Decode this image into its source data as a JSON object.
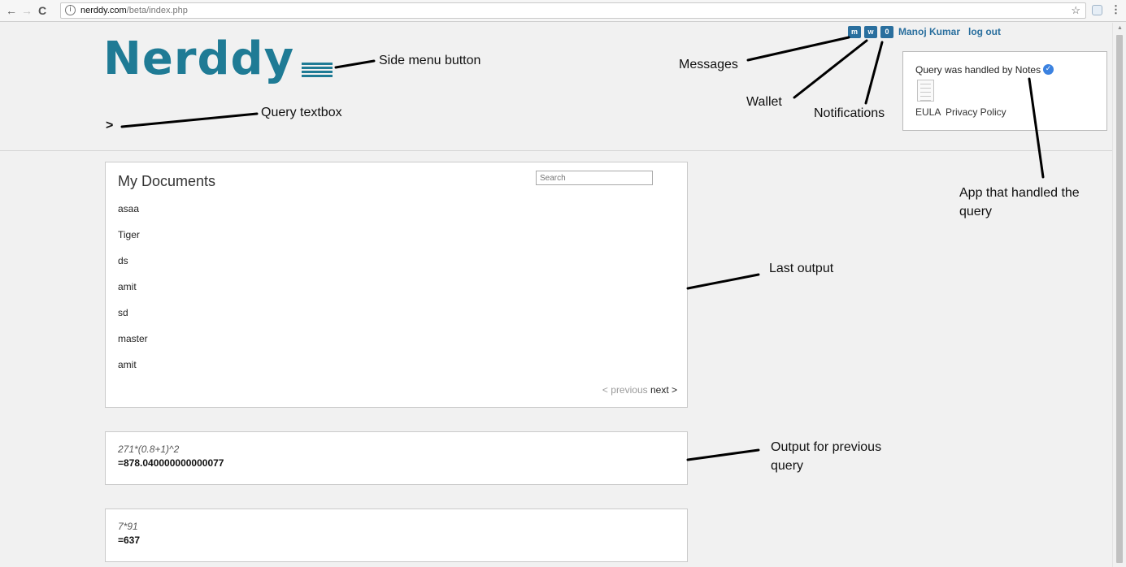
{
  "browser": {
    "url_host": "nerddy.com",
    "url_path": "/beta/index.php",
    "back_icon": "←",
    "forward_icon": "→",
    "reload_icon": "C",
    "info_icon": "i",
    "star_icon": "☆",
    "menu_icon": "⋮"
  },
  "header": {
    "logo": "Nerddy",
    "prompt": ">",
    "badges": {
      "messages": "m",
      "wallet": "w",
      "notifications": "0"
    },
    "user_name": "Manoj Kumar",
    "logout": "log out"
  },
  "handled": {
    "text": "Query was handled by Notes",
    "verified_icon": "✓",
    "eula": "EULA",
    "privacy": "Privacy Policy"
  },
  "documents": {
    "title": "My Documents",
    "search_placeholder": "Search",
    "items": [
      "asaa",
      "Tiger",
      "ds",
      "amit",
      "sd",
      "master",
      "amit"
    ],
    "previous": "< previous",
    "next": "next >"
  },
  "outputs": [
    {
      "expr": "271*(0.8+1)^2",
      "result": "=878.040000000000077"
    },
    {
      "expr": "7*91",
      "result": "=637"
    }
  ],
  "annotations": {
    "side_menu": "Side menu button",
    "query_textbox": "Query textbox",
    "messages": "Messages",
    "wallet": "Wallet",
    "notifications": "Notifications",
    "app_handled_line1": "App that handled the",
    "app_handled_line2": "query",
    "last_output": "Last output",
    "previous_output_line1": "Output for previous",
    "previous_output_line2": "query"
  },
  "colors": {
    "brand": "#1f7b95",
    "badge": "#2a6f9e",
    "verified": "#3b82e0",
    "page_bg": "#f1f1f1"
  }
}
